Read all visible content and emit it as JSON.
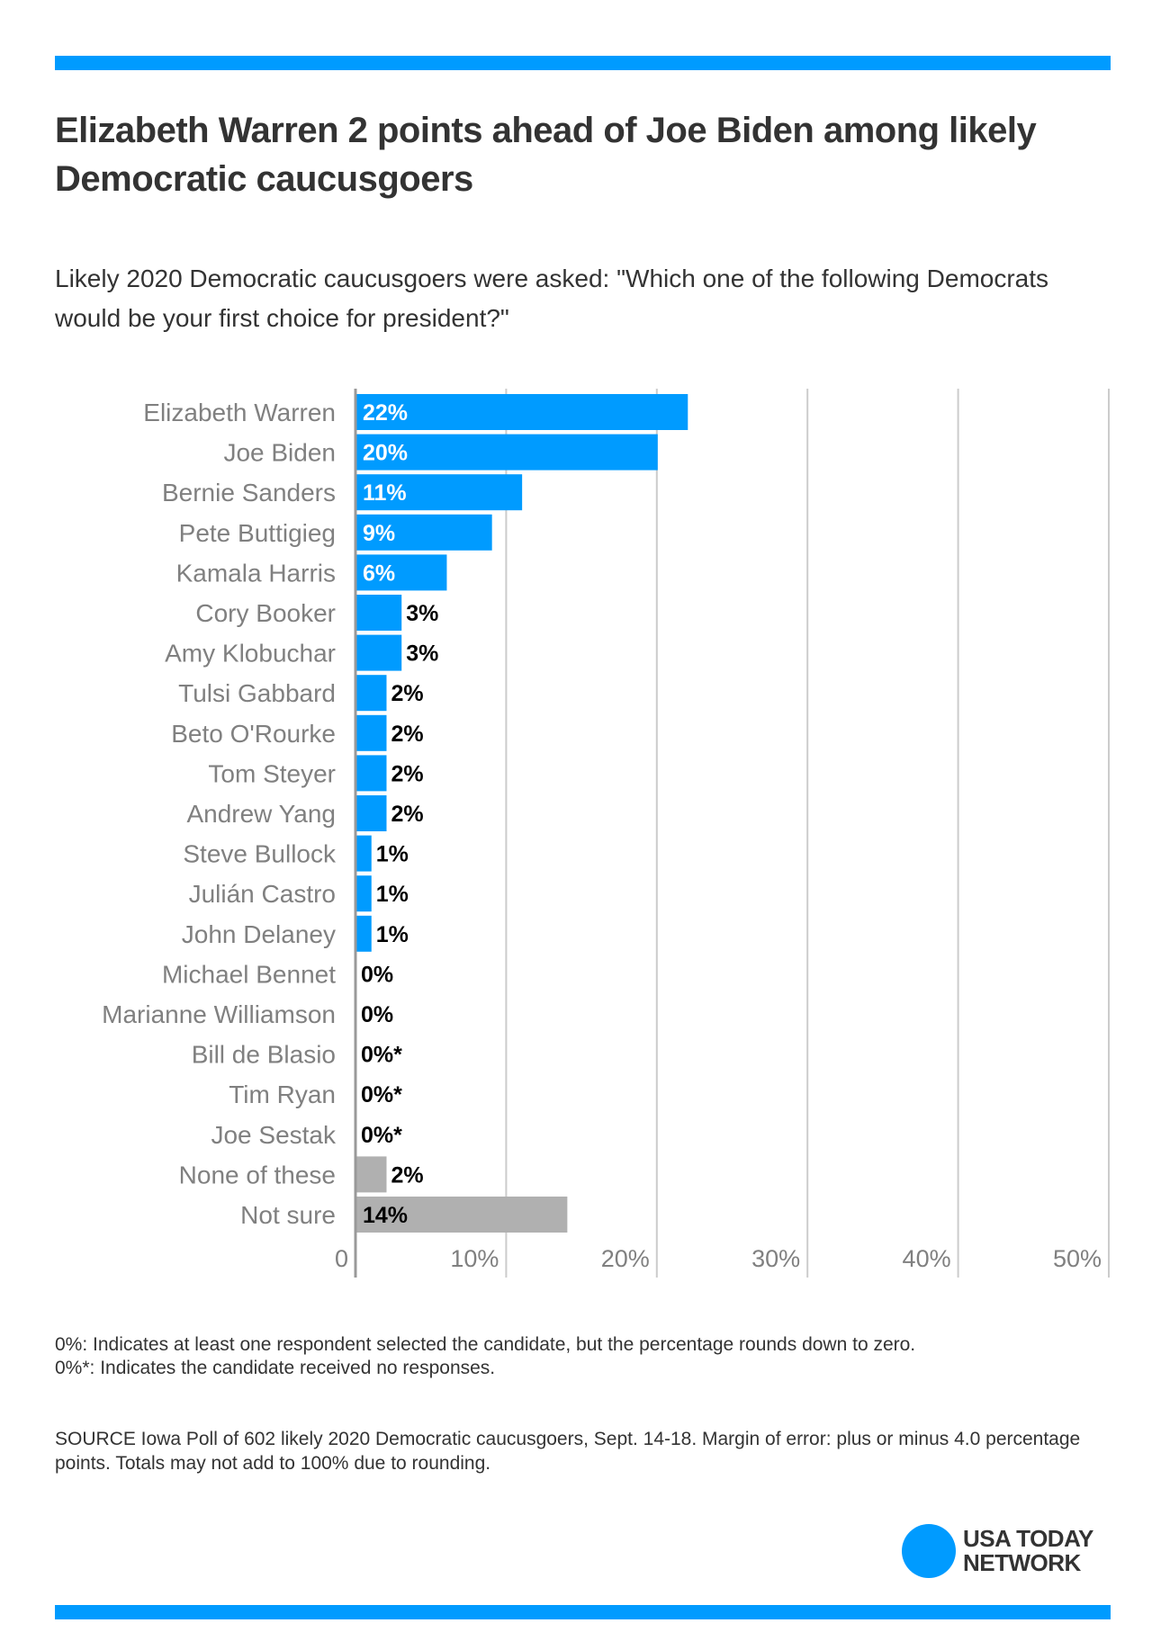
{
  "header": {
    "title": "Elizabeth Warren 2 points ahead of Joe Biden among likely Democratic caucusgoers",
    "subtitle": "Likely 2020 Democratic caucusgoers were asked: \"Which one of the following Democrats would be your first choice for president?\""
  },
  "colors": {
    "accent": "#009bff",
    "candidate_bar": "#009bff",
    "other_bar": "#b0b0b0",
    "label_text": "#808080",
    "value_text_inside": "#ffffff",
    "value_text_outside": "#000000",
    "gridline": "#cccccc",
    "axis": "#999999"
  },
  "chart_data": {
    "type": "bar",
    "orientation": "horizontal",
    "title": "Elizabeth Warren 2 points ahead of Joe Biden among likely Democratic caucusgoers",
    "xlabel": "",
    "ylabel": "",
    "xlim": [
      0,
      50
    ],
    "grid": true,
    "legend": "none",
    "x_ticks": [
      0,
      10,
      20,
      30,
      40,
      50
    ],
    "x_tick_labels": [
      "0",
      "10%",
      "20%",
      "30%",
      "40%",
      "50%"
    ],
    "categories": [
      "Elizabeth Warren",
      "Joe Biden",
      "Bernie Sanders",
      "Pete Buttigieg",
      "Kamala Harris",
      "Cory Booker",
      "Amy Klobuchar",
      "Tulsi Gabbard",
      "Beto O'Rourke",
      "Tom Steyer",
      "Andrew Yang",
      "Steve Bullock",
      "Julián Castro",
      "John Delaney",
      "Michael Bennet",
      "Marianne Williamson",
      "Bill de Blasio",
      "Tim Ryan",
      "Joe Sestak",
      "None of these",
      "Not sure"
    ],
    "values": [
      22,
      20,
      11,
      9,
      6,
      3,
      3,
      2,
      2,
      2,
      2,
      1,
      1,
      1,
      0,
      0,
      0,
      0,
      0,
      2,
      14
    ],
    "labels": [
      "22%",
      "20%",
      "11%",
      "9%",
      "6%",
      "3%",
      "3%",
      "2%",
      "2%",
      "2%",
      "2%",
      "1%",
      "1%",
      "1%",
      "0%",
      "0%",
      "0%*",
      "0%*",
      "0%*",
      "2%",
      "14%"
    ],
    "groups": [
      "candidate",
      "candidate",
      "candidate",
      "candidate",
      "candidate",
      "candidate",
      "candidate",
      "candidate",
      "candidate",
      "candidate",
      "candidate",
      "candidate",
      "candidate",
      "candidate",
      "candidate",
      "candidate",
      "candidate",
      "candidate",
      "candidate",
      "other",
      "other"
    ]
  },
  "footer": {
    "note_1": "0%: Indicates at least one respondent selected the candidate, but the percentage rounds down to zero.",
    "note_2": "0%*: Indicates the candidate received no responses.",
    "source": "SOURCE Iowa Poll of 602 likely 2020 Democratic caucusgoers, Sept. 14-18. Margin of error: plus or minus 4.0 percentage points. Totals may not add to 100% due to rounding.",
    "logo_line_1": "USA TODAY",
    "logo_line_2": "NETWORK"
  }
}
